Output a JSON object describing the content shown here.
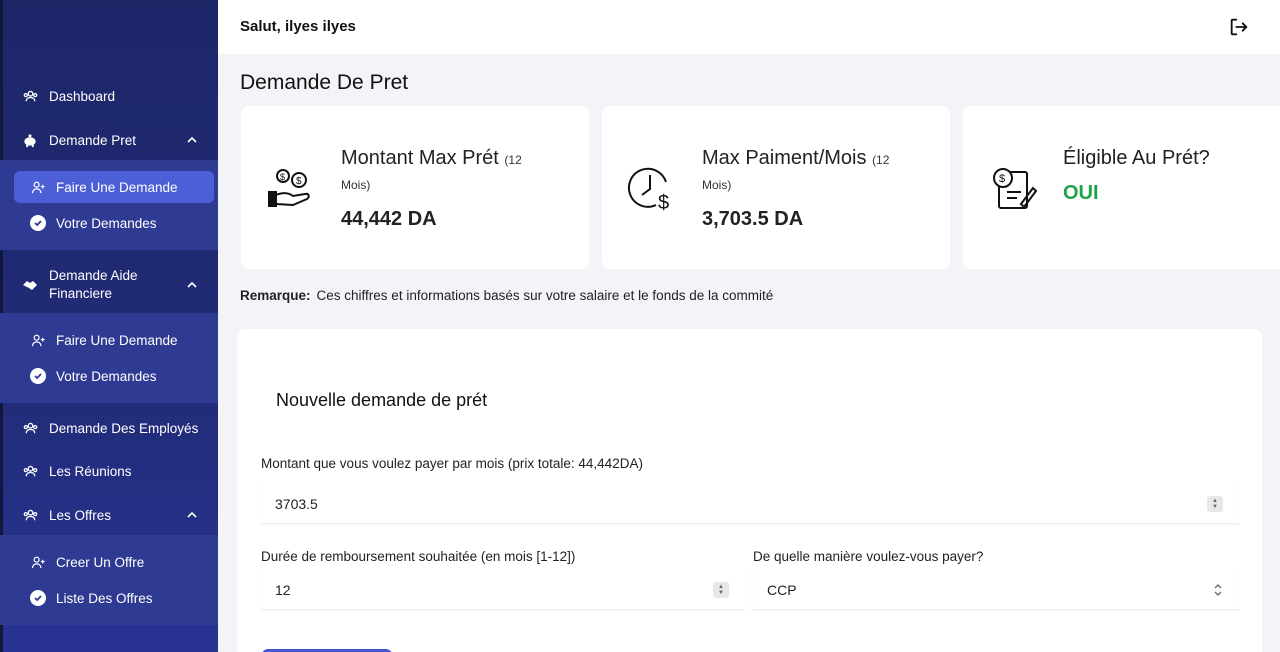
{
  "sidebar": {
    "items": [
      {
        "label": "Dashboard",
        "icon": "users-icon"
      },
      {
        "label": "Demande Pret",
        "icon": "piggy-bank-icon"
      },
      {
        "label": "Demande Aide Financiere",
        "icon": "handshake-icon"
      },
      {
        "label": "Demande Des Employés",
        "icon": "users-icon"
      },
      {
        "label": "Les Réunions",
        "icon": "users-icon"
      },
      {
        "label": "Les Offres",
        "icon": "users-icon"
      }
    ],
    "pret_sub": [
      {
        "label": "Faire Une Demande",
        "icon": "user-plus-icon"
      },
      {
        "label": "Votre Demandes",
        "icon": "check-circle-icon"
      }
    ],
    "aide_sub": [
      {
        "label": "Faire Une Demande",
        "icon": "user-plus-icon"
      },
      {
        "label": "Votre Demandes",
        "icon": "check-circle-icon"
      }
    ],
    "offres_sub": [
      {
        "label": "Creer Un Offre",
        "icon": "user-plus-icon"
      },
      {
        "label": "Liste Des Offres",
        "icon": "check-circle-icon"
      }
    ]
  },
  "header": {
    "greeting": "Salut, ilyes ilyes",
    "logout_icon": "logout-icon"
  },
  "page": {
    "title": "Demande De Pret",
    "remark_label": "Remarque:",
    "remark_text": "Ces chiffres et informations basés sur votre salaire et le fonds de la commité"
  },
  "cards": [
    {
      "title": "Montant Max Prét",
      "qualifier": "(12",
      "qualifier2": "Mois)",
      "value": "44,442 DA",
      "icon": "money-hand-icon"
    },
    {
      "title": "Max Paiment/Mois",
      "qualifier": "(12",
      "qualifier2": "Mois)",
      "value": "3,703.5 DA",
      "icon": "clock-dollar-icon"
    },
    {
      "title": "Éligible Au Prét?",
      "value": "OUI",
      "icon": "document-dollar-icon"
    }
  ],
  "form": {
    "title": "Nouvelle demande de prét",
    "monthly_label": "Montant que vous voulez payer par mois (prix totale: 44,442DA)",
    "monthly_value": "3703.5",
    "duration_label": "Durée de remboursement souhaitée (en mois [1-12])",
    "duration_value": "12",
    "method_label": "De quelle manière voulez-vous payer?",
    "method_value": "CCP"
  },
  "colors": {
    "sidebar": "#1d2667",
    "subpanel": "#2f3a92",
    "active": "#4c5fd6",
    "eligible": "#1ea44a"
  }
}
